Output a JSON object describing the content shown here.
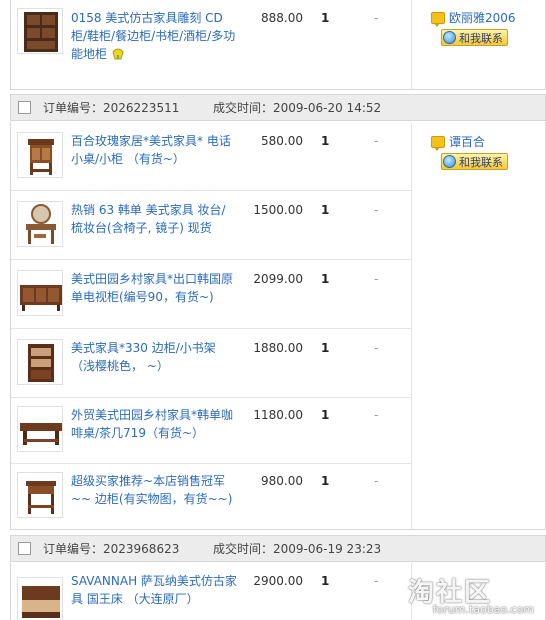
{
  "orders": [
    {
      "id_label": "",
      "time_label": "",
      "seller": "欧丽雅2006",
      "contact_label": "和我联系",
      "items": [
        {
          "title": "0158 美式仿古家具雕刻 CD柜/鞋柜/餐边柜/书柜/酒柜/多功能地柜",
          "price": "888.00",
          "qty": "1",
          "dash": "-",
          "thumb": "wine-cabinet"
        }
      ]
    },
    {
      "id_label": "订单编号：2026223511",
      "time_label": "成交时间：2009-06-20 14:52",
      "seller": "谭百合",
      "contact_label": "和我联系",
      "items": [
        {
          "title": "百合玫瑰家居*美式家具* 电话小桌/小柜 （有货~）",
          "price": "580.00",
          "qty": "1",
          "dash": "-",
          "thumb": "phone-table"
        },
        {
          "title": "热销 63 韩单 美式家具 妆台/梳妆台(含椅子, 镜子) 现货",
          "price": "1500.00",
          "qty": "1",
          "dash": "-",
          "thumb": "vanity"
        },
        {
          "title": "美式田园乡村家具*出口韩国原单电视柜(编号90，有货~)",
          "price": "2099.00",
          "qty": "1",
          "dash": "-",
          "thumb": "tv-cabinet"
        },
        {
          "title": "美式家具*330 边柜/小书架（浅樱桃色， ~）",
          "price": "1880.00",
          "qty": "1",
          "dash": "-",
          "thumb": "bookshelf"
        },
        {
          "title": "外贸美式田园乡村家具*韩单咖啡桌/茶几719（有货~）",
          "price": "1180.00",
          "qty": "1",
          "dash": "-",
          "thumb": "coffee-table"
        },
        {
          "title": "超级买家推荐~本店销售冠军~~ 边柜(有实物图，有货~~)",
          "price": "980.00",
          "qty": "1",
          "dash": "-",
          "thumb": "side-table"
        }
      ]
    },
    {
      "id_label": "订单编号：2023968623",
      "time_label": "成交时间：2009-06-19 23:23",
      "seller": "",
      "contact_label": "",
      "items": [
        {
          "title": "SAVANNAH 萨瓦纳美式仿古家具 国王床 （大连原厂）",
          "price": "2900.00",
          "qty": "1",
          "dash": "-",
          "thumb": "king-bed"
        }
      ]
    }
  ],
  "watermark": {
    "main": "淘社区",
    "sub": "forum.taobao.com"
  },
  "colors": {
    "link": "#2a6bbd",
    "header_bg": "#ececec",
    "border": "#d7d7d7"
  }
}
